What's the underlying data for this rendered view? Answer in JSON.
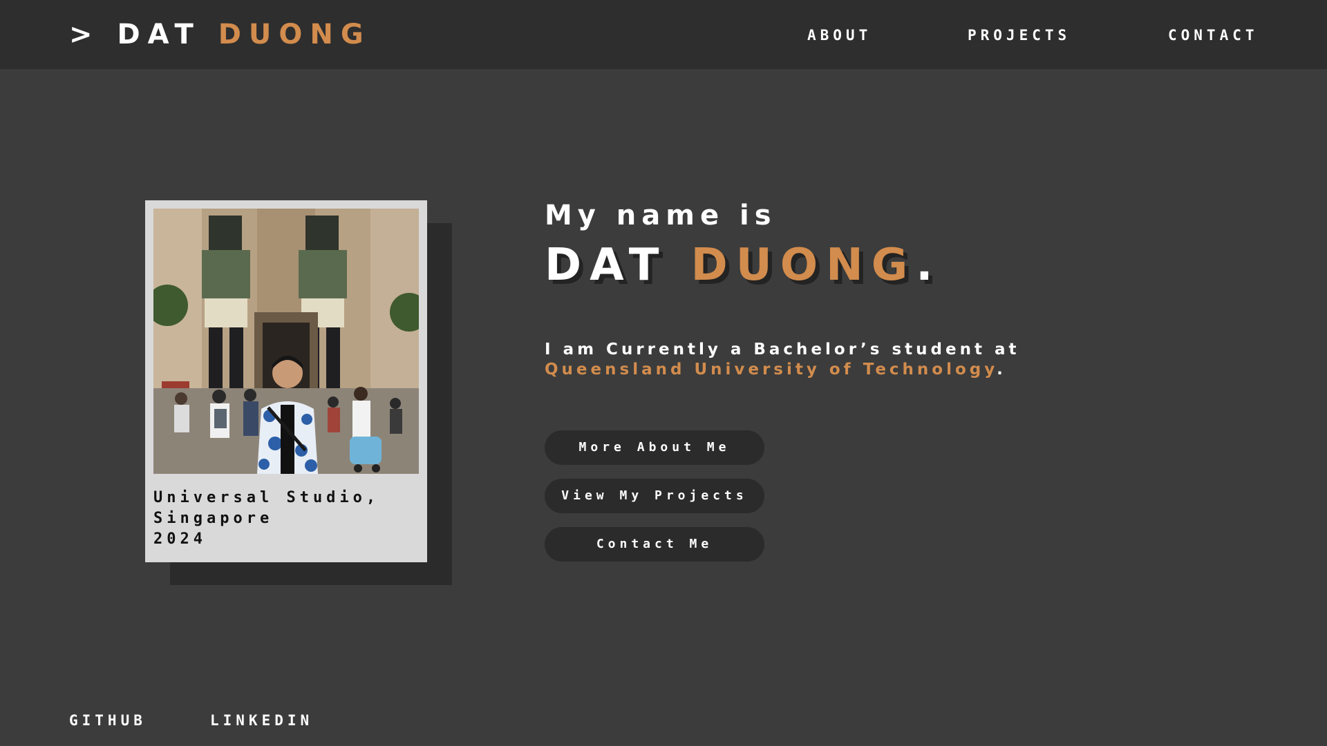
{
  "header": {
    "logo_prompt": "> DAT ",
    "logo_accent": "DUONG",
    "nav": {
      "about": "ABOUT",
      "projects": "PROJECTS",
      "contact": "CONTACT"
    }
  },
  "photo_card": {
    "caption_line1": "Universal Studio,",
    "caption_line2": "Singapore",
    "caption_line3": "2024"
  },
  "hero": {
    "intro": "My name is",
    "name_first": "DAT ",
    "name_last": "DUONG",
    "name_period": ".",
    "desc_line1": "I am Currently a Bachelor’s student at",
    "university": "Queensland University of Technology",
    "desc_end": "."
  },
  "buttons": {
    "more_about": "More About Me",
    "view_projects": "View My Projects",
    "contact": "Contact Me"
  },
  "footer": {
    "github": "GITHUB",
    "linkedin": "LINKEDIN"
  },
  "colors": {
    "accent": "#d28c4d",
    "background": "#3c3c3c",
    "navbar": "#2e2e2e",
    "button": "#2b2b2b",
    "card": "#d9d9d9"
  }
}
